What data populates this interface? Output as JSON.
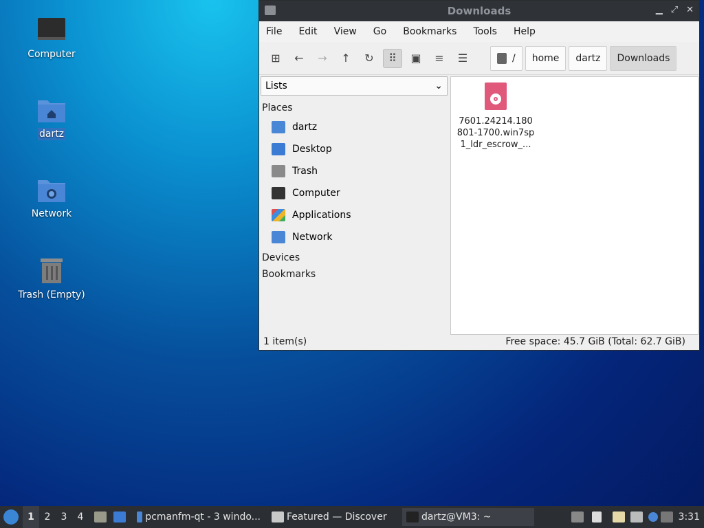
{
  "desktop": {
    "icons": [
      {
        "label": "Computer",
        "icon": "computer-icon"
      },
      {
        "label": "dartz",
        "icon": "home-folder-icon"
      },
      {
        "label": "Network",
        "icon": "network-folder-icon"
      },
      {
        "label": "Trash (Empty)",
        "icon": "trash-icon"
      }
    ]
  },
  "window": {
    "title": "Downloads",
    "menu": [
      "File",
      "Edit",
      "View",
      "Go",
      "Bookmarks",
      "Tools",
      "Help"
    ],
    "toolbar": {
      "icons": [
        "new-tab-icon",
        "back-icon",
        "forward-icon",
        "up-icon",
        "reload-icon",
        "icon-view-icon",
        "thumbnail-view-icon",
        "compact-view-icon",
        "detailed-list-icon"
      ]
    },
    "path": [
      "/",
      "home",
      "dartz",
      "Downloads"
    ],
    "sidebar": {
      "mode": "Lists",
      "sections": {
        "places": "Places",
        "devices": "Devices",
        "bookmarks": "Bookmarks"
      },
      "places": [
        {
          "label": "dartz",
          "icon": "home-folder-icon",
          "color": "#4a86d6"
        },
        {
          "label": "Desktop",
          "icon": "desktop-icon",
          "color": "#3b7bd4"
        },
        {
          "label": "Trash",
          "icon": "trash-icon",
          "color": "#8a8a8a"
        },
        {
          "label": "Computer",
          "icon": "computer-icon",
          "color": "#333333"
        },
        {
          "label": "Applications",
          "icon": "applications-icon",
          "color": "#e04f4f"
        },
        {
          "label": "Network",
          "icon": "network-folder-icon",
          "color": "#4a86d6"
        }
      ]
    },
    "files": [
      {
        "name": "7601.24214.180801-1700.win7sp1_ldr_escrow_...",
        "line1": "7601.24214.180",
        "line2": "801-1700.win7sp",
        "line3": "1_ldr_escrow_...",
        "icon": "disc-image-icon",
        "color": "#e0587a"
      }
    ],
    "status": {
      "items": "1 item(s)",
      "space": "Free space: 45.7 GiB (Total: 62.7 GiB)"
    }
  },
  "taskbar": {
    "desktops": [
      "1",
      "2",
      "3",
      "4"
    ],
    "tasks": [
      {
        "label": "pcmanfm-qt - 3 windo...",
        "icon": "folder-icon"
      },
      {
        "label": "Featured — Discover",
        "icon": "discover-icon"
      },
      {
        "label": "dartz@VM3: ~",
        "icon": "terminal-icon"
      }
    ],
    "clock": "3:31"
  }
}
